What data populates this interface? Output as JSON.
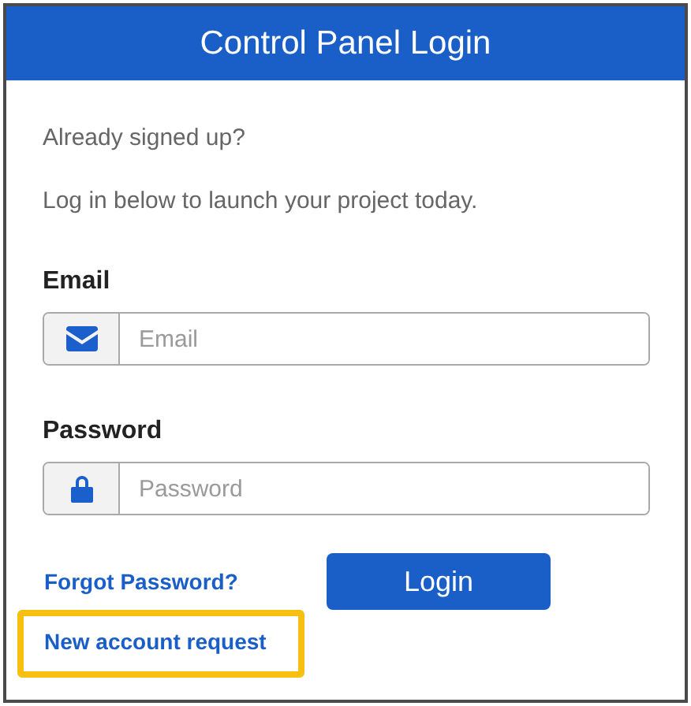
{
  "header": {
    "title": "Control Panel Login"
  },
  "intro": [
    "Already signed up?",
    "Log in below to launch your project today."
  ],
  "fields": [
    {
      "kind": "email",
      "label": "Email",
      "placeholder": "Email"
    },
    {
      "kind": "password",
      "label": "Password",
      "placeholder": "Password"
    }
  ],
  "links": [
    {
      "label": "Forgot Password?",
      "highlighted": false
    },
    {
      "label": "New account request",
      "highlighted": true
    }
  ],
  "login_button": "Login"
}
